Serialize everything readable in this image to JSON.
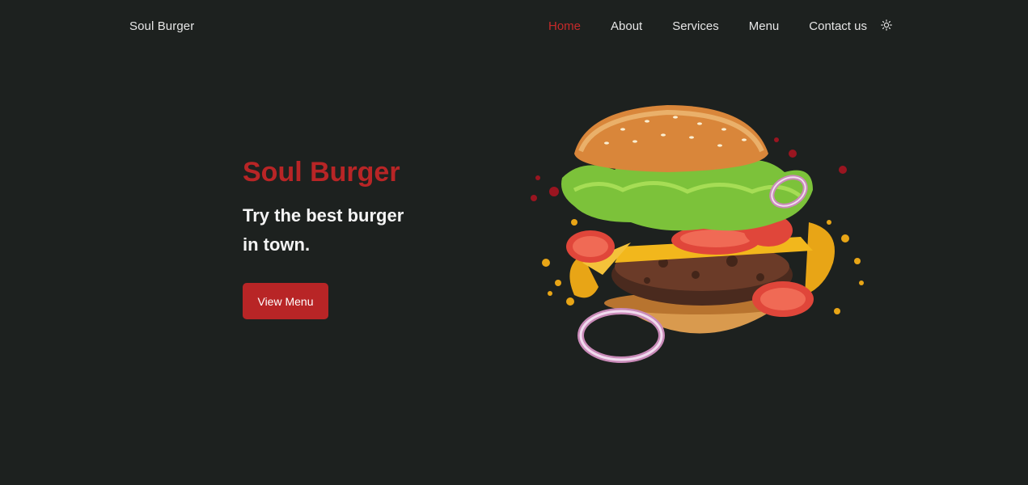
{
  "header": {
    "brand": "Soul Burger",
    "nav": [
      {
        "label": "Home",
        "active": true
      },
      {
        "label": "About",
        "active": false
      },
      {
        "label": "Services",
        "active": false
      },
      {
        "label": "Menu",
        "active": false
      },
      {
        "label": "Contact us",
        "active": false
      }
    ],
    "theme_icon": "sun-icon"
  },
  "hero": {
    "title": "Soul Burger",
    "subtitle_line1": "Try the best burger",
    "subtitle_line2": "in town.",
    "button_label": "View Menu",
    "image": "burger-illustration"
  },
  "colors": {
    "background": "#1d211f",
    "accent": "#b82526",
    "active_nav": "#c62a2a",
    "text": "#e6e6e6"
  }
}
